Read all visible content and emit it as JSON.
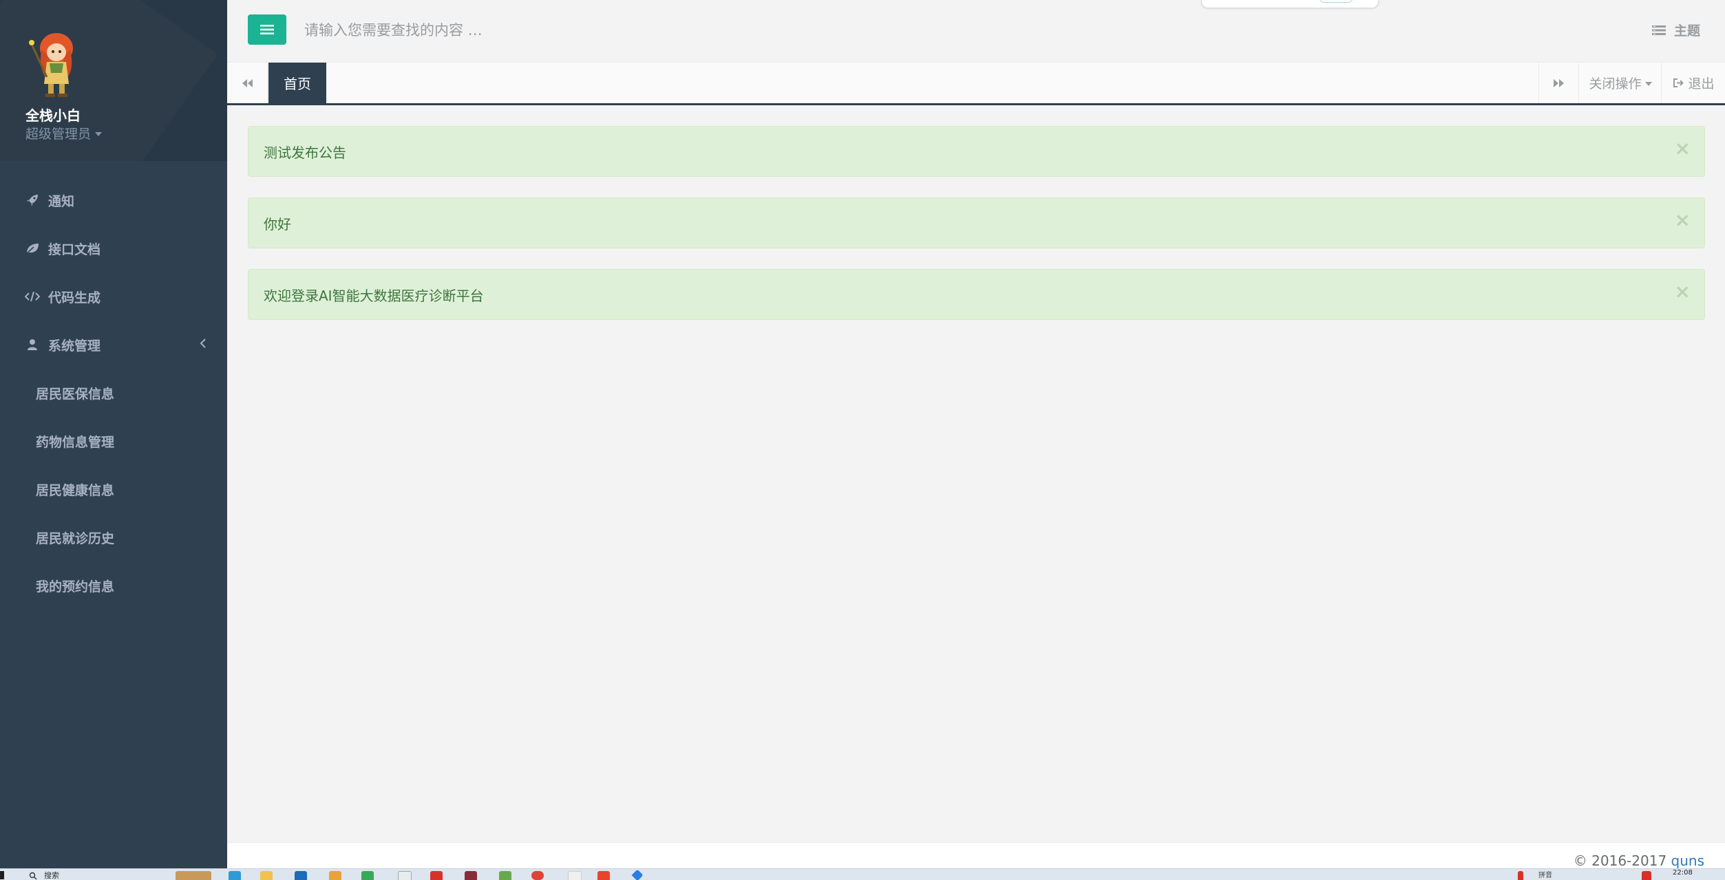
{
  "sidebar": {
    "user": {
      "name": "全栈小白",
      "role": "超级管理员"
    },
    "menu": [
      {
        "label": "通知",
        "icon": "rocket-icon"
      },
      {
        "label": "接口文档",
        "icon": "leaf-icon"
      },
      {
        "label": "代码生成",
        "icon": "code-icon"
      },
      {
        "label": "系统管理",
        "icon": "user-icon",
        "expanded": true
      }
    ],
    "submenu": [
      {
        "label": "居民医保信息"
      },
      {
        "label": "药物信息管理"
      },
      {
        "label": "居民健康信息"
      },
      {
        "label": "居民就诊历史"
      },
      {
        "label": "我的预约信息"
      }
    ]
  },
  "topbar": {
    "search_placeholder": "请输入您需要查找的内容 …",
    "theme_label": "主题"
  },
  "tabs": {
    "items": [
      {
        "label": "首页",
        "active": true
      }
    ],
    "close_ops_label": "关闭操作",
    "logout_label": "退出"
  },
  "notices": [
    {
      "text": "测试发布公告"
    },
    {
      "text": "你好"
    },
    {
      "text": "欢迎登录AI智能大数据医疗诊断平台"
    }
  ],
  "footer": {
    "copyright": "© 2016-2017 ",
    "author": "quns"
  },
  "taskbar": {
    "search_text": "搜索",
    "clock": "22:08",
    "tray_text": "拼音"
  },
  "colors": {
    "sidebar_bg": "#2f4050",
    "accent": "#1ab394",
    "alert_bg": "#dff0d8",
    "alert_text": "#3c763d"
  }
}
